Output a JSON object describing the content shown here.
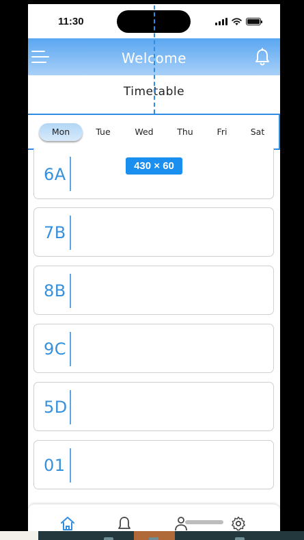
{
  "status_bar": {
    "time": "11:30"
  },
  "header": {
    "title": "Welcome"
  },
  "page": {
    "title": "Timetable"
  },
  "days": [
    "Mon",
    "Tue",
    "Wed",
    "Thu",
    "Fri",
    "Sat"
  ],
  "selected_day": "Mon",
  "classes": [
    "6A",
    "7B",
    "8B",
    "9C",
    "5D",
    "01"
  ],
  "overlay": {
    "dimension_label": "430 × 60"
  },
  "colors": {
    "accent": "#2e8de2",
    "header_top": "#5aa6f1",
    "header_bottom": "#a8d0f8",
    "class_text": "#3690dc"
  },
  "icons": {
    "menu": "menu-icon",
    "bell": "bell-icon",
    "home": "home-icon",
    "profile": "profile-icon",
    "settings": "gear-icon"
  }
}
